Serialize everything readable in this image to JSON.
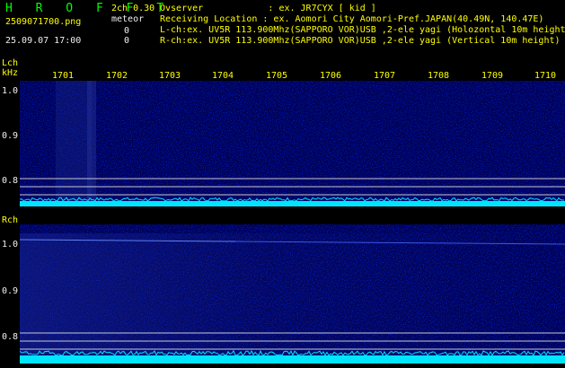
{
  "header": {
    "app_title": "H R O F F T",
    "mode": "2ch 0.30",
    "event_label": "meteor",
    "filename": "2509071700.png",
    "datetime": "25.09.07 17:00",
    "count_l": "0",
    "count_r": "0",
    "observer_line": "Ovserver            : ex. JR7CYX [ kid ]",
    "location_line": "Receiving Location : ex. Aomori City Aomori-Pref.JAPAN(40.49N, 140.47E)",
    "lch_line": "L-ch:ex. UV5R 113.900Mhz(SAPPORO VOR)USB ,2-ele yagi (Holozontal 10m height)",
    "rch_line": "R-ch:ex. UV5R 113.900Mhz(SAPPORO VOR)USB ,2-ele yagi (Vertical 10m height)"
  },
  "time_axis": {
    "labels": [
      "1701",
      "1702",
      "1703",
      "1704",
      "1705",
      "1706",
      "1707",
      "1708",
      "1709",
      "1710"
    ]
  },
  "lch": {
    "channel_label": "Lch",
    "unit_label": "kHz",
    "y_ticks": [
      "1.0",
      "0.9",
      "0.8"
    ]
  },
  "rch": {
    "channel_label": "Rch",
    "y_ticks": [
      "1.0",
      "0.9",
      "0.8"
    ]
  },
  "colors": {
    "background": "#000000",
    "spectrogram_base": "#00007a",
    "signal_line": "#4a6cff",
    "power_trace": "#00e5ff",
    "label_yellow": "#ffff00",
    "label_white": "#f0f0f0",
    "title_green": "#00ff00"
  }
}
